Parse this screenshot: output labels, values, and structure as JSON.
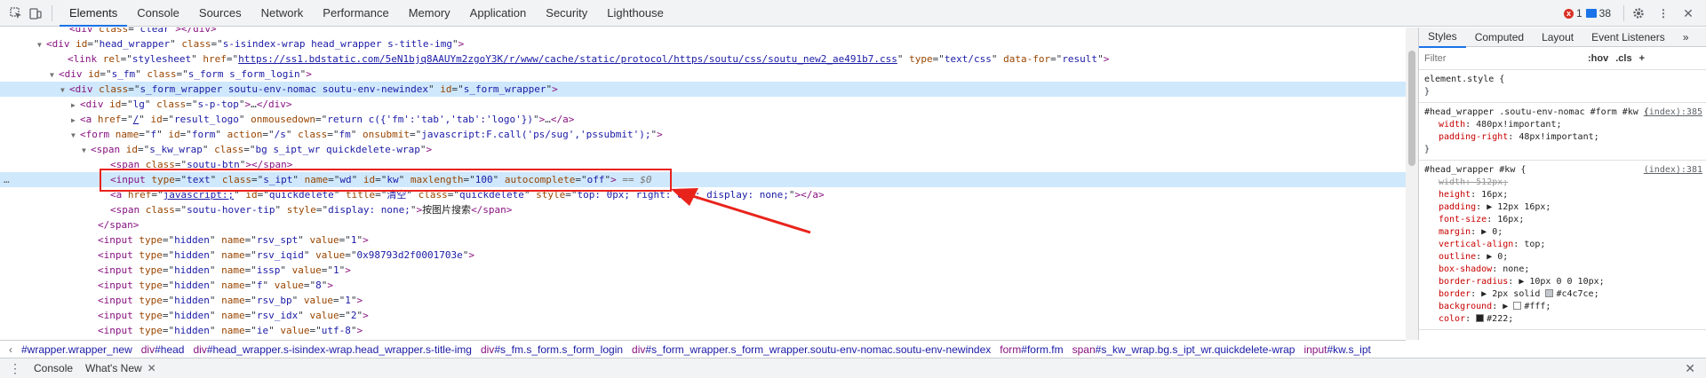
{
  "tabs": [
    "Elements",
    "Console",
    "Sources",
    "Network",
    "Performance",
    "Memory",
    "Application",
    "Security",
    "Lighthouse"
  ],
  "status": {
    "errors": "1",
    "messages": "38"
  },
  "dom_lines": [
    {
      "indent": 78,
      "html": "<span class='tag'>&lt;div</span> <span class='an'>class</span>=\"<span class='av'>clear</span>\"<span class='tag'>&gt;&lt;/div&gt;</span>"
    },
    {
      "indent": 52,
      "tri": "▼",
      "html": "<span class='tag'>&lt;div</span> <span class='an'>id</span>=\"<span class='av'>head_wrapper</span>\" <span class='an'>class</span>=\"<span class='av'>s-isindex-wrap head_wrapper s-title-img</span>\"<span class='tag'>&gt;</span>"
    },
    {
      "indent": 76,
      "html": "<span class='tag'>&lt;link</span> <span class='an'>rel</span>=\"<span class='av'>stylesheet</span>\" <span class='an'>href</span>=\"<span class='link'>https://ss1.bdstatic.com/5eN1bjq8AAUYm2zgoY3K/r/www/cache/static/protocol/https/soutu/css/soutu_new2_ae491b7.css</span>\" <span class='an'>type</span>=\"<span class='av'>text/css</span>\" <span class='an'>data-for</span>=\"<span class='av'>result</span>\"<span class='tag'>&gt;</span>"
    },
    {
      "indent": 66,
      "tri": "▼",
      "html": "<span class='tag'>&lt;div</span> <span class='an'>id</span>=\"<span class='av'>s_fm</span>\" <span class='an'>class</span>=\"<span class='av'>s_form s_form_login</span>\"<span class='tag'>&gt;</span>"
    },
    {
      "indent": 78,
      "tri": "▼",
      "hl": true,
      "html": "<span class='tag'>&lt;div</span> <span class='an'>class</span>=\"<span class='av'>s_form_wrapper soutu-env-nomac soutu-env-newindex</span>\" <span class='an'>id</span>=\"<span class='av'>s_form_wrapper</span>\"<span class='tag'>&gt;</span>"
    },
    {
      "indent": 90,
      "tri": "▶",
      "html": "<span class='tag'>&lt;div</span> <span class='an'>id</span>=\"<span class='av'>lg</span>\" <span class='an'>class</span>=\"<span class='av'>s-p-top</span>\"<span class='tag'>&gt;</span>…<span class='tag'>&lt;/div&gt;</span>"
    },
    {
      "indent": 90,
      "tri": "▶",
      "html": "<span class='tag'>&lt;a</span> <span class='an'>href</span>=\"<span class='link'>/</span>\" <span class='an'>id</span>=\"<span class='av'>result_logo</span>\" <span class='an'>onmousedown</span>=\"<span class='av'>return c({'fm':'tab','tab':'logo'})</span>\"<span class='tag'>&gt;</span>…<span class='tag'>&lt;/a&gt;</span>"
    },
    {
      "indent": 90,
      "tri": "▼",
      "html": "<span class='tag'>&lt;form</span> <span class='an'>name</span>=\"<span class='av'>f</span>\" <span class='an'>id</span>=\"<span class='av'>form</span>\" <span class='an'>action</span>=\"<span class='av'>/s</span>\" <span class='an'>class</span>=\"<span class='av'>fm</span>\" <span class='an'>onsubmit</span>=\"<span class='av'>javascript:F.call('ps/sug','pssubmit');</span>\"<span class='tag'>&gt;</span>"
    },
    {
      "indent": 102,
      "tri": "▼",
      "html": "<span class='tag'>&lt;span</span> <span class='an'>id</span>=\"<span class='av'>s_kw_wrap</span>\" <span class='an'>class</span>=\"<span class='av'>bg s_ipt_wr quickdelete-wrap</span>\"<span class='tag'>&gt;</span>"
    },
    {
      "indent": 124,
      "html": "<span class='tag'>&lt;span</span> <span class='an'>class</span>=\"<span class='av'>soutu-btn</span>\"<span class='tag'>&gt;&lt;/span&gt;</span>"
    },
    {
      "indent": 124,
      "hl": true,
      "dots": true,
      "html": "<span class='tag'>&lt;input</span> <span class='an'>type</span>=\"<span class='av'>text</span>\" <span class='an'>class</span>=\"<span class='av'>s_ipt</span>\" <span class='an'>name</span>=\"<span class='av'>wd</span>\" <span class='an'>id</span>=\"<span class='av'>kw</span>\" <span class='an'>maxlength</span>=\"<span class='av'>100</span>\" <span class='an'>autocomplete</span>=\"<span class='av'>off</span>\"<span class='tag'>&gt;</span> <span class='cm'>== <i>$0</i></span>"
    },
    {
      "indent": 124,
      "html": "<span class='tag'>&lt;a</span> <span class='an'>href</span>=\"<span class='link'>javascript:;</span>\" <span class='an'>id</span>=\"<span class='av'>quickdelete</span>\" <span class='an'>title</span>=\"<span class='av'>清空</span>\" <span class='an'>class</span>=\"<span class='av'>quickdelete</span>\" <span class='an'>style</span>=\"<span class='av'>top: 0px; right: 0px; display: none;</span>\"<span class='tag'>&gt;&lt;/a&gt;</span>"
    },
    {
      "indent": 124,
      "html": "<span class='tag'>&lt;span</span> <span class='an'>class</span>=\"<span class='av'>soutu-hover-tip</span>\" <span class='an'>style</span>=\"<span class='av'>display: none;</span>\"<span class='tag'>&gt;</span><span class='txt'>按图片搜索</span><span class='tag'>&lt;/span&gt;</span>"
    },
    {
      "indent": 110,
      "html": "<span class='tag'>&lt;/span&gt;</span>"
    },
    {
      "indent": 110,
      "html": "<span class='tag'>&lt;input</span> <span class='an'>type</span>=\"<span class='av'>hidden</span>\" <span class='an'>name</span>=\"<span class='av'>rsv_spt</span>\" <span class='an'>value</span>=\"<span class='av'>1</span>\"<span class='tag'>&gt;</span>"
    },
    {
      "indent": 110,
      "html": "<span class='tag'>&lt;input</span> <span class='an'>type</span>=\"<span class='av'>hidden</span>\" <span class='an'>name</span>=\"<span class='av'>rsv_iqid</span>\" <span class='an'>value</span>=\"<span class='av'>0x98793d2f0001703e</span>\"<span class='tag'>&gt;</span>"
    },
    {
      "indent": 110,
      "html": "<span class='tag'>&lt;input</span> <span class='an'>type</span>=\"<span class='av'>hidden</span>\" <span class='an'>name</span>=\"<span class='av'>issp</span>\" <span class='an'>value</span>=\"<span class='av'>1</span>\"<span class='tag'>&gt;</span>"
    },
    {
      "indent": 110,
      "html": "<span class='tag'>&lt;input</span> <span class='an'>type</span>=\"<span class='av'>hidden</span>\" <span class='an'>name</span>=\"<span class='av'>f</span>\" <span class='an'>value</span>=\"<span class='av'>8</span>\"<span class='tag'>&gt;</span>"
    },
    {
      "indent": 110,
      "html": "<span class='tag'>&lt;input</span> <span class='an'>type</span>=\"<span class='av'>hidden</span>\" <span class='an'>name</span>=\"<span class='av'>rsv_bp</span>\" <span class='an'>value</span>=\"<span class='av'>1</span>\"<span class='tag'>&gt;</span>"
    },
    {
      "indent": 110,
      "html": "<span class='tag'>&lt;input</span> <span class='an'>type</span>=\"<span class='av'>hidden</span>\" <span class='an'>name</span>=\"<span class='av'>rsv_idx</span>\" <span class='an'>value</span>=\"<span class='av'>2</span>\"<span class='tag'>&gt;</span>"
    },
    {
      "indent": 110,
      "html": "<span class='tag'>&lt;input</span> <span class='an'>type</span>=\"<span class='av'>hidden</span>\" <span class='an'>name</span>=\"<span class='av'>ie</span>\" <span class='an'>value</span>=\"<span class='av'>utf-8</span>\"<span class='tag'>&gt;</span>"
    }
  ],
  "styles_tabs": [
    "Styles",
    "Computed",
    "Layout",
    "Event Listeners"
  ],
  "filter_placeholder": "Filter",
  "filter_buttons": [
    ":hov",
    ".cls",
    "+"
  ],
  "rules": [
    {
      "selector": "element.style {",
      "source": "",
      "props": [],
      "close": "}"
    },
    {
      "selector": "#head_wrapper .soutu-env-nomac #form #kw {",
      "source": "(index):385",
      "props": [
        {
          "n": "width",
          "v": "480px!important;"
        },
        {
          "n": "padding-right",
          "v": "48px!important;"
        }
      ],
      "close": "}"
    },
    {
      "selector": "#head_wrapper #kw {",
      "source": "(index):381",
      "props": [
        {
          "n": "width",
          "v": "512px;",
          "struck": true
        },
        {
          "n": "height",
          "v": "16px;"
        },
        {
          "n": "padding",
          "v": "▶ 12px 16px;"
        },
        {
          "n": "font-size",
          "v": "16px;"
        },
        {
          "n": "margin",
          "v": "▶ 0;"
        },
        {
          "n": "vertical-align",
          "v": "top;"
        },
        {
          "n": "outline",
          "v": "▶ 0;"
        },
        {
          "n": "box-shadow",
          "v": "none;"
        },
        {
          "n": "border-radius",
          "v": "▶ 10px 0 0 10px;"
        },
        {
          "n": "border",
          "v": "▶ 2px solid",
          "swatch": "#c4c7ce",
          "v2": "#c4c7ce;"
        },
        {
          "n": "background",
          "v": "▶",
          "swatch": "#fff",
          "v2": "#fff;"
        },
        {
          "n": "color",
          "v": "",
          "swatch": "#222",
          "v2": "#222;"
        }
      ],
      "close": ""
    }
  ],
  "breadcrumbs": [
    {
      "t": "",
      "r": "#wrapper.wrapper_new"
    },
    {
      "t": "div",
      "r": "#head"
    },
    {
      "t": "div",
      "r": "#head_wrapper.s-isindex-wrap.head_wrapper.s-title-img"
    },
    {
      "t": "div",
      "r": "#s_fm.s_form.s_form_login"
    },
    {
      "t": "div",
      "r": "#s_form_wrapper.s_form_wrapper.soutu-env-nomac.soutu-env-newindex"
    },
    {
      "t": "form",
      "r": "#form.fm"
    },
    {
      "t": "span",
      "r": "#s_kw_wrap.bg.s_ipt_wr.quickdelete-wrap"
    },
    {
      "t": "input",
      "r": "#kw.s_ipt"
    }
  ],
  "drawer": {
    "console": "Console",
    "whats_new": "What's New"
  },
  "colors": {
    "accent": "#1a73e8",
    "highlight": "#cfe8fc",
    "annotation": "#e8231b"
  }
}
